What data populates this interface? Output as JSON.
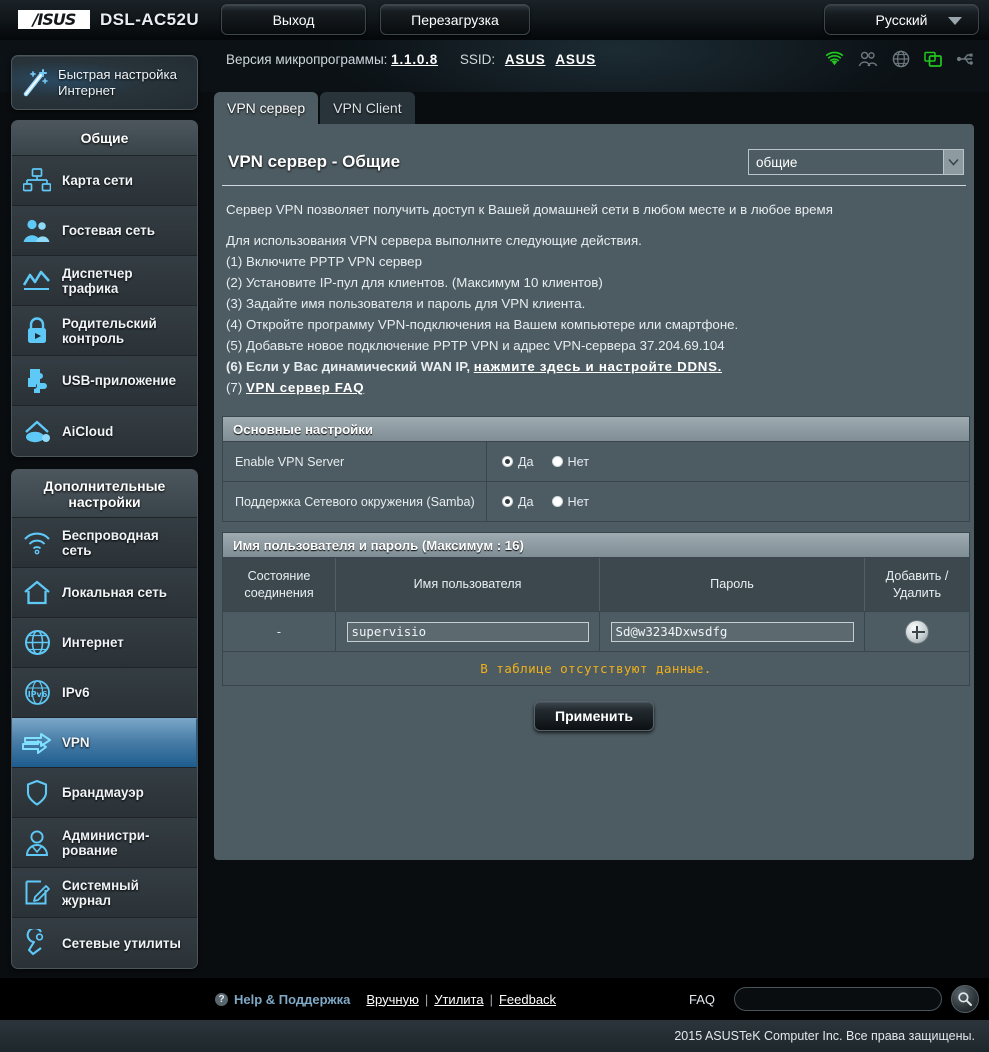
{
  "header": {
    "brand": "/ISUS",
    "model": "DSL-AC52U",
    "logout_label": "Выход",
    "reboot_label": "Перезагрузка",
    "language": "Русский",
    "firmware_label": "Версия микропрограммы:",
    "firmware_version": "1.1.0.8",
    "ssid_label": "SSID:",
    "ssid_1": "ASUS",
    "ssid_2": "ASUS",
    "quick_setup_line1": "Быстрая настройка",
    "quick_setup_line2": "Интернет",
    "status_icons": [
      {
        "name": "wifi-icon",
        "color": "#22c81e"
      },
      {
        "name": "guest-network-icon",
        "color": "#6e7a80"
      },
      {
        "name": "globe-icon",
        "color": "#6e7a80"
      },
      {
        "name": "display-icon",
        "color": "#22c81e"
      },
      {
        "name": "usb-icon",
        "color": "#6e7a80"
      }
    ]
  },
  "sidebar": {
    "groups": [
      {
        "title": "Общие",
        "items": [
          {
            "label": "Карта сети",
            "icon": "network-map-icon",
            "active": false
          },
          {
            "label": "Гостевая сеть",
            "icon": "guest-network-icon",
            "active": false
          },
          {
            "label": "Диспетчер трафика",
            "icon": "traffic-manager-icon",
            "active": false
          },
          {
            "label": "Родительский контроль",
            "icon": "parental-control-icon",
            "active": false
          },
          {
            "label": "USB-приложение",
            "icon": "usb-application-icon",
            "active": false
          },
          {
            "label": "AiCloud",
            "icon": "aicloud-icon",
            "active": false
          }
        ]
      },
      {
        "title": "Дополнительные настройки",
        "items": [
          {
            "label": "Беспроводная сеть",
            "icon": "wireless-icon",
            "active": false
          },
          {
            "label": "Локальная сеть",
            "icon": "lan-icon",
            "active": false
          },
          {
            "label": "Интернет",
            "icon": "wan-icon",
            "active": false
          },
          {
            "label": "IPv6",
            "icon": "ipv6-icon",
            "active": false
          },
          {
            "label": "VPN",
            "icon": "vpn-icon",
            "active": true
          },
          {
            "label": "Брандмауэр",
            "icon": "firewall-icon",
            "active": false
          },
          {
            "label": "Администри-рование",
            "icon": "administration-icon",
            "active": false
          },
          {
            "label": "Системный журнал",
            "icon": "system-log-icon",
            "active": false
          },
          {
            "label": "Сетевые утилиты",
            "icon": "network-tools-icon",
            "active": false
          }
        ]
      }
    ]
  },
  "tabs": [
    {
      "label": "VPN сервер",
      "active": true
    },
    {
      "label": "VPN Client",
      "active": false
    }
  ],
  "main": {
    "title": "VPN сервер - Общие",
    "mode_select_value": "общие",
    "intro": "Сервер VPN позволяет получить доступ к Вашей домашней сети в любом месте и в любое время",
    "howto_header": "Для использования VPN сервера выполните следующие действия.",
    "steps": [
      "(1) Включите PPTP VPN сервер",
      "(2) Установите IP-пул для клиентов. (Максимум 10 клиентов)",
      "(3) Задайте имя пользователя и пароль для VPN клиента.",
      "(4) Откройте программу VPN-подключения на Вашем компьютере или смартфоне.",
      "(5) Добавьте новое подключение PPTP VPN и адрес VPN-сервера 37.204.69.104"
    ],
    "step6_prefix": "(6) Если у Вас динамический WAN IP, ",
    "step6_link": "нажмите  здесь  и  настройте  DDNS.",
    "step7_prefix": "(7) ",
    "step7_link": "VPN  сервер  FAQ",
    "basic_section_title": "Основные настройки",
    "settings": [
      {
        "label": "Enable VPN Server",
        "options": [
          {
            "label": "Да",
            "checked": true
          },
          {
            "label": "Нет",
            "checked": false
          }
        ]
      },
      {
        "label": "Поддержка Сетевого окружения (Samba)",
        "options": [
          {
            "label": "Да",
            "checked": true
          },
          {
            "label": "Нет",
            "checked": false
          }
        ]
      }
    ],
    "users_section_title": "Имя пользователя и пароль (Максимум : 16)",
    "users_table": {
      "headers": [
        "Состояние соединения",
        "Имя пользователя",
        "Пароль",
        "Добавить / Удалить"
      ],
      "rows": [
        {
          "status": "-",
          "username": "supervisio",
          "password": "Sd@w3234Dxwsdfg",
          "action_icon": "add-icon"
        }
      ],
      "empty_message": "В таблице отсутствуют данные."
    },
    "apply_label": "Применить"
  },
  "footer": {
    "help_icon_glyph": "?",
    "help_label": "Help & Поддержка",
    "links": [
      "Вручную",
      "Утилита",
      "Feedback"
    ],
    "separator": "|",
    "faq_label": "FAQ",
    "faq_value": "",
    "faq_placeholder": "",
    "search_icon": "search-icon",
    "copyright": "2015 ASUSTeK Computer Inc. Все права защищены."
  }
}
